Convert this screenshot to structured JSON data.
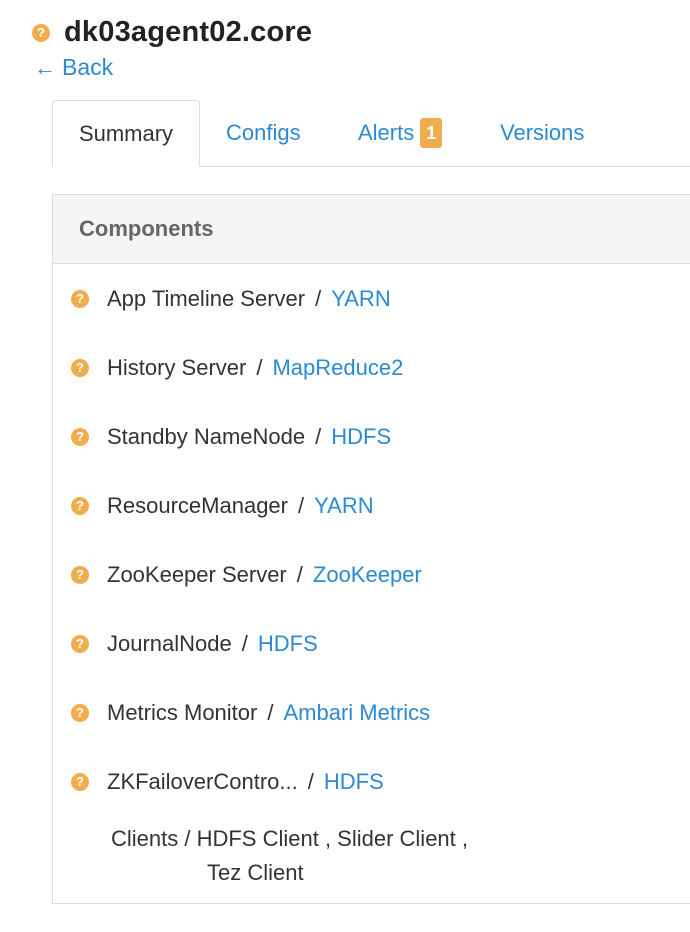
{
  "host": {
    "status_icon": "?",
    "name": "dk03agent02.core"
  },
  "back": {
    "arrow": "🡐",
    "label": "Back"
  },
  "tabs": [
    {
      "label": "Summary",
      "active": true
    },
    {
      "label": "Configs"
    },
    {
      "label": "Alerts",
      "badge": "1"
    },
    {
      "label": "Versions"
    }
  ],
  "components": {
    "heading": "Components",
    "status_icon": "?",
    "separator": "/",
    "rows": [
      {
        "name": "App Timeline Server",
        "service": "YARN"
      },
      {
        "name": "History Server",
        "service": "MapReduce2"
      },
      {
        "name": "Standby NameNode",
        "service": "HDFS"
      },
      {
        "name": "ResourceManager",
        "service": "YARN"
      },
      {
        "name": "ZooKeeper Server",
        "service": "ZooKeeper"
      },
      {
        "name": "JournalNode",
        "service": "HDFS"
      },
      {
        "name": "Metrics Monitor",
        "service": "Ambari Metrics"
      },
      {
        "name": "ZKFailoverContro...",
        "service": "HDFS"
      }
    ],
    "clients": {
      "line1": "Clients / HDFS Client , Slider Client ,",
      "line2": "Tez Client"
    }
  },
  "colors": {
    "warning": "#f0ad4e",
    "link": "#2b8ad3"
  }
}
